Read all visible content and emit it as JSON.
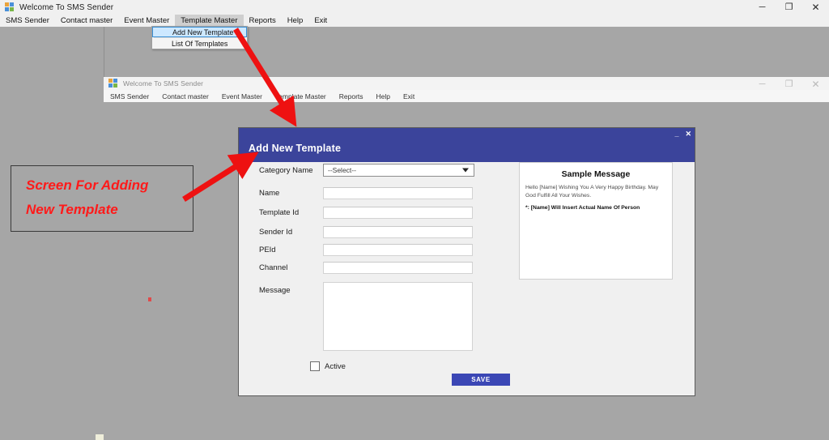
{
  "outer_window": {
    "title": "Welcome To SMS Sender",
    "icon": "app-icon",
    "controls": {
      "minimize": "─",
      "maximize": "❐",
      "close": "✕"
    },
    "menu": [
      "SMS Sender",
      "Contact master",
      "Event Master",
      "Template Master",
      "Reports",
      "Help",
      "Exit"
    ],
    "open_menu": "Template Master",
    "dropdown": {
      "items": [
        "Add New Template",
        "List Of Templates"
      ],
      "selected": "Add New Template"
    }
  },
  "inner_window": {
    "title": "Welcome To SMS Sender",
    "controls": {
      "minimize": "─",
      "maximize": "❐",
      "close": "✕"
    },
    "menu": [
      "SMS Sender",
      "Contact master",
      "Event Master",
      "Template Master",
      "Reports",
      "Help",
      "Exit"
    ]
  },
  "dialog": {
    "title": "Add New Template",
    "controls": {
      "minimize": "_",
      "close": "✕"
    },
    "fields": [
      {
        "label": "Category Name",
        "type": "select",
        "value": "--Select--"
      },
      {
        "label": "Name",
        "type": "text",
        "value": ""
      },
      {
        "label": "Template Id",
        "type": "text",
        "value": ""
      },
      {
        "label": "Sender Id",
        "type": "text",
        "value": ""
      },
      {
        "label": "PEId",
        "type": "text",
        "value": ""
      },
      {
        "label": "Channel",
        "type": "text",
        "value": ""
      },
      {
        "label": "Message",
        "type": "textarea",
        "value": ""
      }
    ],
    "active_checkbox": {
      "label": "Active",
      "checked": false
    },
    "save_button": "SAVE",
    "sample_panel": {
      "title": "Sample Message",
      "body": "Hello [Name] Wishing You A Very Happy Birthday. May God Fulfill All Your Wishes.",
      "note": "*: [Name] Will Insert Actual Name Of Person"
    }
  },
  "annotation": {
    "line1": "Screen For Adding",
    "line2": "New Template",
    "color": "#ff1a1a",
    "arrows": 2
  },
  "colors": {
    "desktop_background": "#a6a6a6",
    "dialog_header": "#3b449b",
    "dialog_body": "#f0f0f0",
    "save_button": "#3b47b5",
    "menu_highlight": "#cde8ff",
    "annotation_red": "#ff1a1a"
  }
}
